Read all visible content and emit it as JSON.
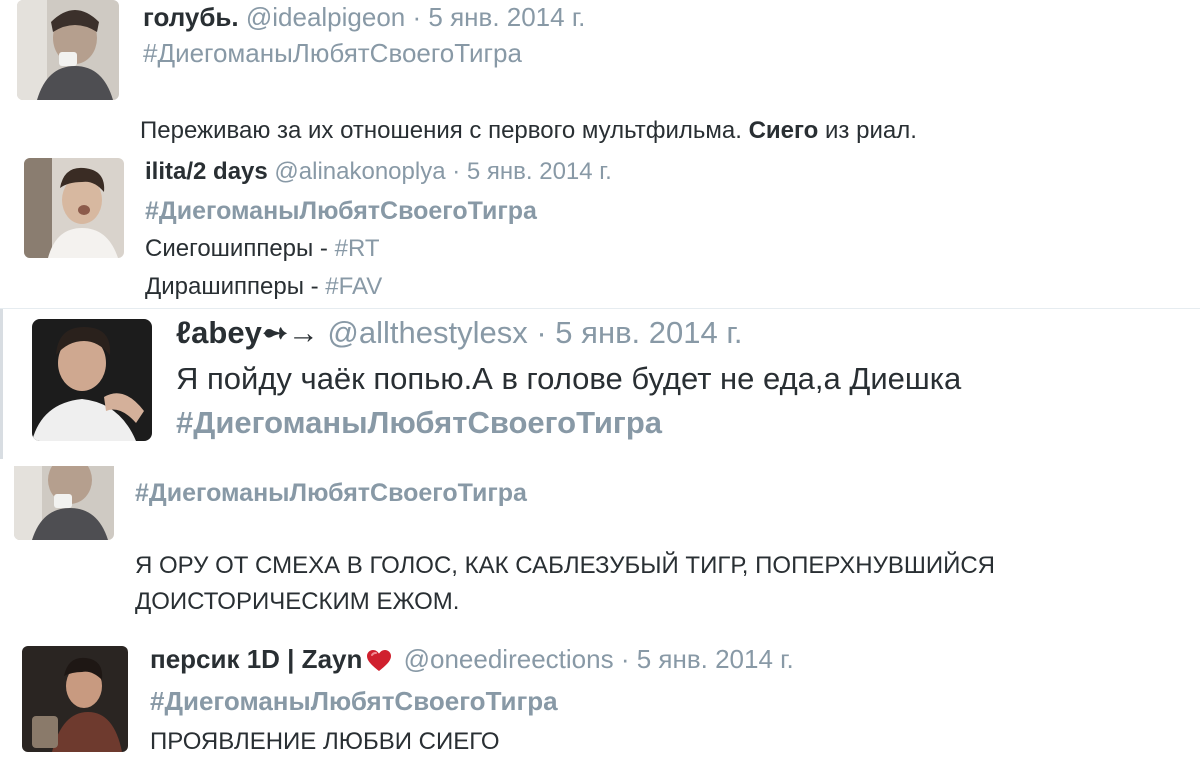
{
  "tweets": [
    {
      "name": "голубь.",
      "handle": "@idealpigeon",
      "date": "· 5 янв. 2014 г.",
      "hashtag": "#ДиегоманыЛюбятСвоегоТигра",
      "text_before": "Переживаю за их отношения с первого мультфильма. ",
      "text_bold": "Сиего",
      "text_after": " из риал."
    },
    {
      "name": "ilita/2 days",
      "handle": "@alinakonoplya",
      "date": "· 5 янв. 2014 г.",
      "hashtag": "#ДиегоманыЛюбятСвоегоТигра",
      "line1_text": "Сиегошипперы - ",
      "line1_tag": "#RT",
      "line2_text": "Дирашипперы - ",
      "line2_tag": "#FAV"
    },
    {
      "name": "ℓabey",
      "name_suffix": "➻→",
      "handle": "@allthestylesx",
      "date": "· 5 янв. 2014 г.",
      "text": "Я пойду чаёк попью.А в голове будет не еда,а Диешка",
      "hashtag": "#ДиегоманыЛюбятСвоегоТигра"
    },
    {
      "hashtag": "#ДиегоманыЛюбятСвоегоТигра",
      "text_line1": "Я ОРУ ОТ СМЕХА В ГОЛОС, КАК САБЛЕЗУБЫЙ ТИГР, ПОПЕРХНУВШИЙСЯ",
      "text_line2": "ДОИСТОРИЧЕСКИМ ЕЖОМ."
    },
    {
      "name": "персик 1D | Zayn",
      "handle": "@oneedireections",
      "date": "· 5 янв. 2014 г.",
      "hashtag": "#ДиегоманыЛюбятСвоегоТигра",
      "text": "ПРОЯВЛЕНИЕ ЛЮБВИ СИЕГО"
    }
  ],
  "icons": {
    "heart": "heart-icon",
    "avatar": "avatar"
  },
  "colors": {
    "text": "#292f33",
    "muted": "#8899a6",
    "heart": "#d0202e"
  }
}
